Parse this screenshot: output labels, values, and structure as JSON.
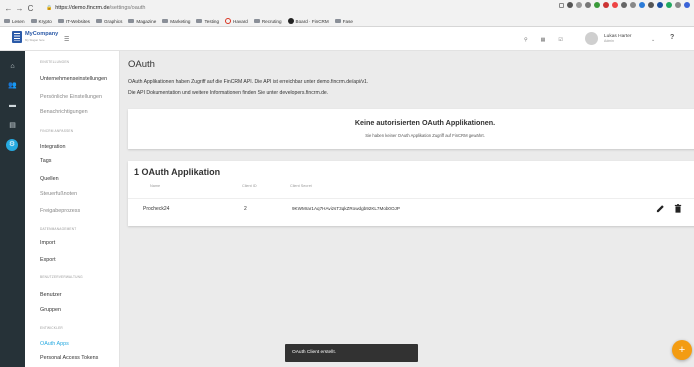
{
  "browser": {
    "url_host": "https://demo.fincrm.de",
    "url_path": "/settings/oauth",
    "bookmarks": [
      "Lesen",
      "Krypto",
      "IT-Websites",
      "Graphics",
      "Magazine",
      "Marketing",
      "Testing",
      "Havard",
      "Recruting",
      "Board · FinCRM",
      "Fase"
    ]
  },
  "topbar": {
    "logo_name": "MyCompany",
    "logo_tagline": "My Slogan here",
    "user_name": "Lukas Harter",
    "user_role": "Admin"
  },
  "menu": {
    "sections": {
      "einstellungen": "EINSTELLUNGEN",
      "fincrm": "FINCRM ANPASSEN",
      "daten": "DATENMANAGEMENT",
      "benutzer": "BENUTZERVERWALTUNG",
      "entwickler": "ENTWICKLER"
    },
    "items": {
      "unternehmen": "Unternehmenseinstellungen",
      "persoenlich": "Persönliche Einstellungen",
      "benachrichtigungen": "Benachrichtigungen",
      "integration": "Integration",
      "tags": "Tags",
      "quellen": "Quellen",
      "steuer": "Steuerfußnoten",
      "freigabe": "Freigabeprozess",
      "import": "Import",
      "export": "Export",
      "benutzer": "Benutzer",
      "gruppen": "Gruppen",
      "oauth": "OAuth Apps",
      "tokens": "Personal Access Tokens"
    }
  },
  "page": {
    "title": "OAuth",
    "desc_line1": "OAuth Applikationen haben Zugriff auf die FinCRM API. Die API ist erreichbar unter demo.fincrm.de/api/v1.",
    "desc_line2": "Die API Dokumentation und weitere Informationen finden Sie unter developers.fincrm.de.",
    "authorized": {
      "heading": "Keine autorisierten OAuth Applikationen.",
      "subtext": "Sie haben keiner OAuth Applikation Zugriff auf FinCRM gewährt."
    },
    "apps": {
      "heading": "1 OAuth Applikation",
      "columns": [
        "Name",
        "Client ID",
        "Client Secret"
      ],
      "rows": [
        {
          "name": "Procheck24",
          "client_id": "2",
          "client_secret": "9KWMrar1Aq7HAvizsT3qkZRowdgb92KL7Mob0OJP"
        }
      ]
    }
  },
  "toast": "OAuth Client erstellt.",
  "fab_label": "+",
  "colors": {
    "accent": "#26a9e0",
    "rail": "#263238",
    "fab": "#f39c12",
    "brand": "#2b5aa8"
  }
}
